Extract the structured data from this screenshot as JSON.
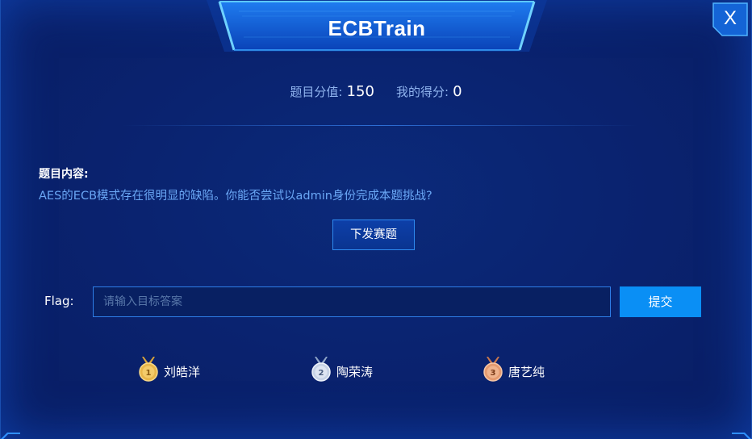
{
  "dialog": {
    "title": "ECBTrain",
    "close_label": "X"
  },
  "score": {
    "points_label": "题目分值:",
    "points_value": "150",
    "my_score_label": "我的得分:",
    "my_score_value": "0"
  },
  "content": {
    "heading": "题目内容:",
    "description": "AES的ECB模式存在很明显的缺陷。你能否尝试以admin身份完成本题挑战?"
  },
  "issue_button_label": "下发赛题",
  "flag": {
    "label": "Flag:",
    "placeholder": "请输入目标答案",
    "value": "",
    "submit_label": "提交"
  },
  "top_solvers": [
    {
      "rank": "1",
      "name": "刘皓洋",
      "medal": "gold-medal-icon",
      "color": "#e8b64a"
    },
    {
      "rank": "2",
      "name": "陶荣涛",
      "medal": "silver-medal-icon",
      "color": "#c7d3e6"
    },
    {
      "rank": "3",
      "name": "唐艺纯",
      "medal": "bronze-medal-icon",
      "color": "#e59a6f"
    }
  ],
  "colors": {
    "background": "#0a2370",
    "accent": "#0a8ff5",
    "description_text": "#6aa7f5",
    "label_text": "#8fb3ee"
  }
}
